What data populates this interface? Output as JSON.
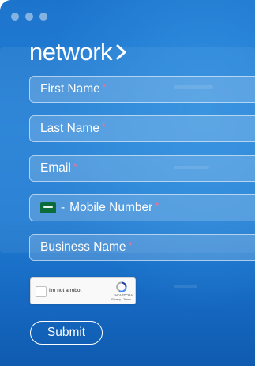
{
  "window": {
    "dots": [
      "",
      "",
      ""
    ]
  },
  "brand": {
    "logo_text": "network",
    "logo_mark": "chevron-right"
  },
  "form": {
    "first_name_placeholder": "First Name",
    "last_name_placeholder": "Last Name",
    "email_placeholder": "Email",
    "mobile_placeholder": "Mobile Number",
    "mobile_prefix": "-",
    "business_name_placeholder": "Business Name",
    "required_marker": "*",
    "country_flag": "saudi-arabia-flag"
  },
  "recaptcha": {
    "label": "I'm not a robot",
    "brand": "reCAPTCHA",
    "terms": "Privacy - Terms"
  },
  "submit": {
    "label": "Submit"
  },
  "colors": {
    "background": "#1f7bd2",
    "required": "#ff6b8e",
    "field_border": "#ffffff"
  }
}
